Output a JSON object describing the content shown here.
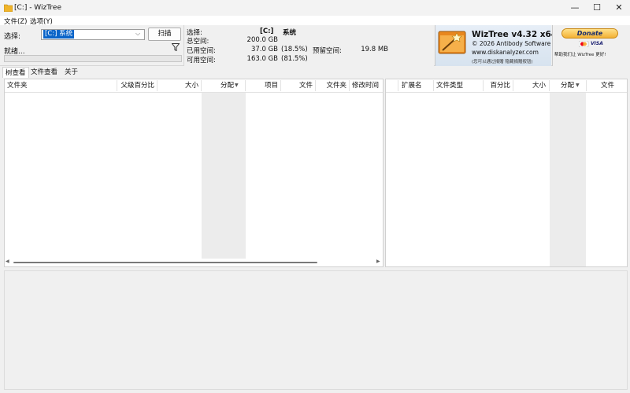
{
  "window": {
    "title": "[C:]  - WizTree",
    "controls": {
      "minimize": "—",
      "maximize": "☐",
      "close": "✕"
    }
  },
  "menu": [
    {
      "label": "文件(Z)"
    },
    {
      "label": "选项(Y)"
    }
  ],
  "scan": {
    "select_label": "选择:",
    "drive_value": "[C:] 系统",
    "scan_button": "扫描",
    "status": "就绪..."
  },
  "stats": {
    "select_label": "选择:",
    "drive_letter": "[C:]",
    "drive_name": "系统",
    "total_label": "总空间:",
    "total_value": "200.0 GB",
    "used_label": "已用空间:",
    "used_value": "37.0 GB",
    "used_pct": "(18.5%)",
    "free_label": "可用空间:",
    "free_value": "163.0 GB",
    "free_pct": "(81.5%)",
    "reserved_label": "预留空间:",
    "reserved_value": "19.8 MB"
  },
  "about": {
    "app_name": "WizTree v4.32 x64",
    "copyright": "© 2026 Antibody Software",
    "website": "www.diskanalyzer.com",
    "disk_note": "(您可以通过捐赠 隐藏捐赠按钮)"
  },
  "donate": {
    "button": "Donate",
    "card1": "VISA",
    "text": "帮助我们让 WizTree 更好!"
  },
  "tabs": [
    {
      "label": "树查看"
    },
    {
      "label": "文件查看"
    },
    {
      "label": "关于"
    }
  ],
  "tree_columns": [
    "文件夹",
    "父级百分比",
    "大小",
    "分配",
    "项目",
    "文件",
    "文件夹",
    "修改时间"
  ],
  "ext_columns": [
    "扩展名",
    "文件类型",
    "百分比",
    "大小",
    "分配",
    "文件"
  ],
  "colors": {
    "accent": "#0a64c8",
    "donate_gold": "#f3b234",
    "logo_orange": "#e8871e"
  }
}
